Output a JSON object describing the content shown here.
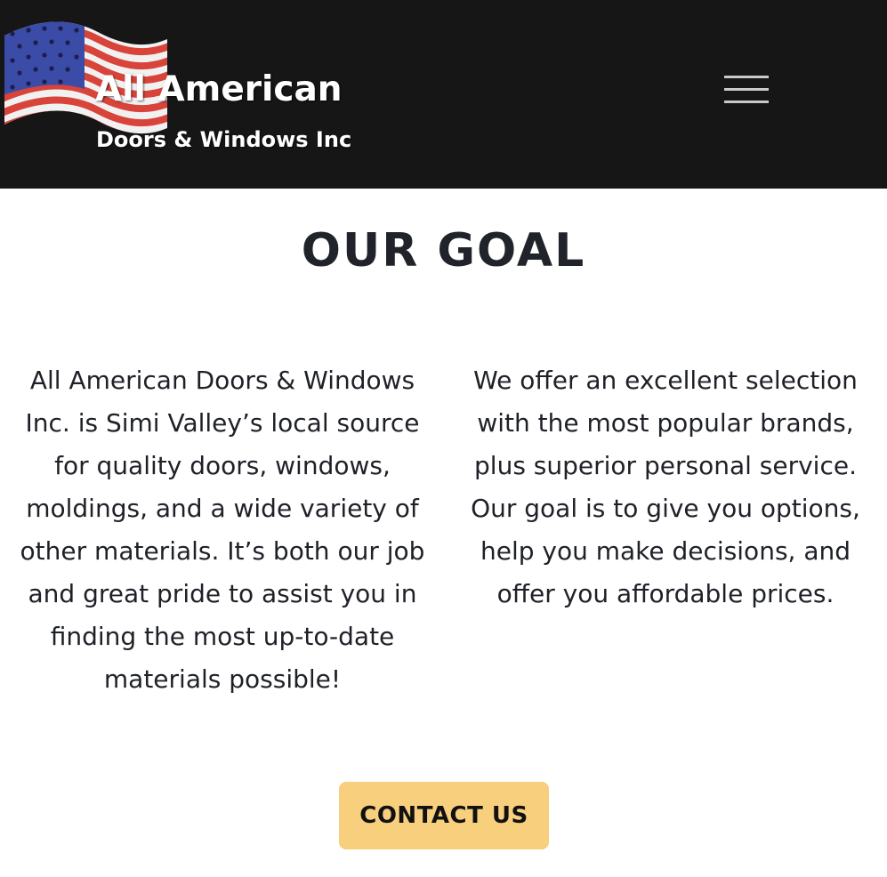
{
  "header": {
    "logo": {
      "icon": "american-flag-icon",
      "line1": "All American",
      "line2": "Doors & Windows Inc"
    },
    "menu_icon": "hamburger-menu-icon"
  },
  "main": {
    "title": "OUR GOAL",
    "left_paragraph": "All American Doors & Windows Inc. is Simi Valley’s local source for quality doors, windows, moldings, and a wide variety of other materials. It’s both our job and great pride to assist you in finding the most up-to-date materials possible!",
    "right_paragraph": "We offer an excellent selection with the most popular brands, plus superior personal service. Our goal is to give you options, help you make decisions, and offer you affordable prices.",
    "contact_label": "CONTACT US"
  },
  "colors": {
    "header_bg": "#161616",
    "button_bg": "#f7cf7d",
    "flag_red": "#d8433a",
    "flag_blue": "#3b4ba8"
  }
}
